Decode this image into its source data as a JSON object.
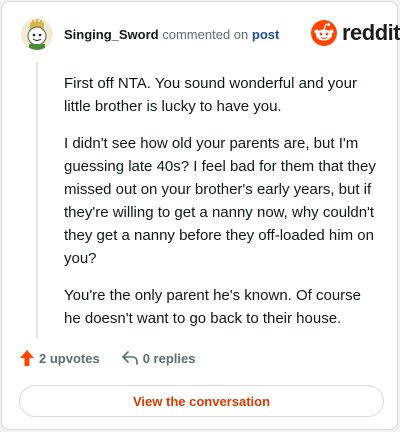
{
  "comment": {
    "username": "Singing_Sword",
    "action_text": "commented on",
    "post_link": "post",
    "paragraphs": [
      "First off NTA. You sound wonderful and your little brother is lucky to have you.",
      "I didn't see how old your parents are, but I'm guessing late 40s? I feel bad for them that they missed out on your brother's early years, but if they're willing to get a nanny now, why couldn't they get a nanny before they off-loaded him on you?",
      "You're the only parent he's known. Of course he doesn't want to go back to their house."
    ]
  },
  "brand": {
    "logo_text": "reddit",
    "accent": "#ff4500"
  },
  "actions": {
    "upvotes": "2 upvotes",
    "replies": "0 replies"
  },
  "cta": {
    "label": "View the conversation"
  },
  "icons": {
    "avatar": "avatar-illustration",
    "upvote": "upvote-arrow-icon",
    "reply": "reply-arrow-icon",
    "logo": "reddit-snoo-icon"
  }
}
